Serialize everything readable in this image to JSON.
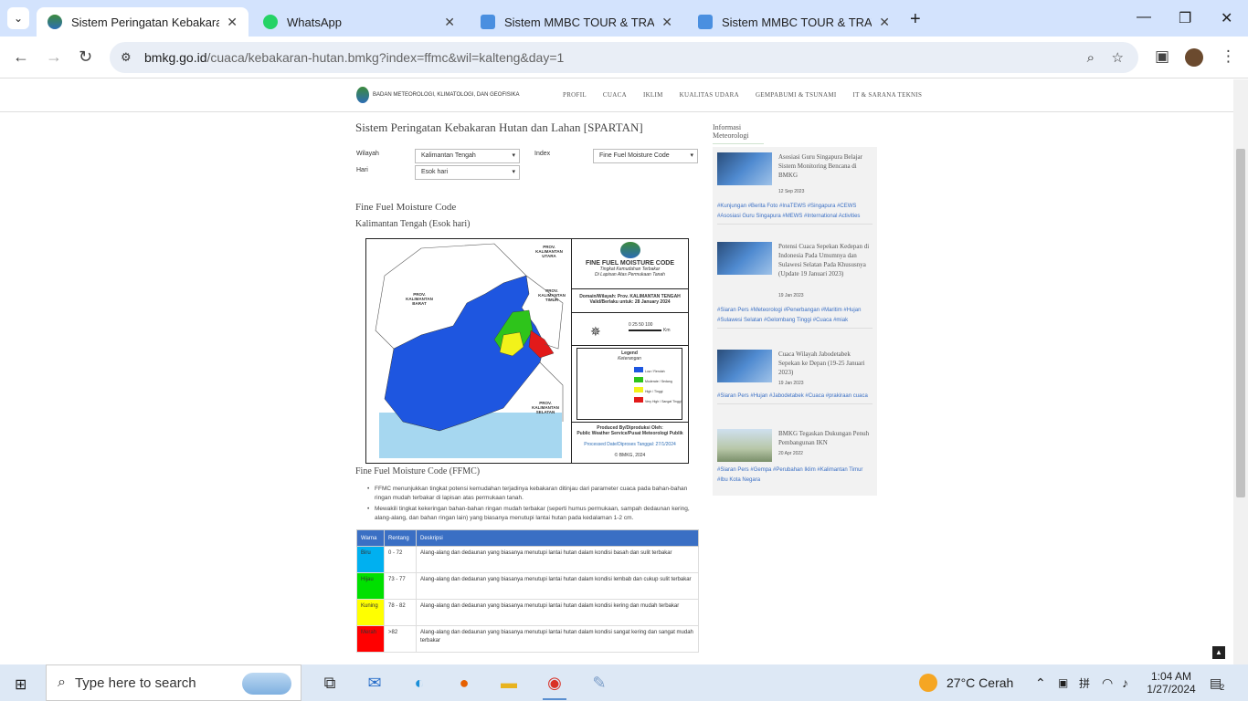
{
  "browser": {
    "tabs": [
      {
        "title": "Sistem Peringatan Kebakaran H",
        "active": true
      },
      {
        "title": "WhatsApp",
        "active": false
      },
      {
        "title": "Sistem MMBC TOUR & TRAVEL",
        "active": false
      },
      {
        "title": "Sistem MMBC TOUR & TRAVEL",
        "active": false
      }
    ],
    "url_host": "bmkg.go.id",
    "url_path": "/cuaca/kebakaran-hutan.bmkg?index=ffmc&wil=kalteng&day=1"
  },
  "site": {
    "logo_text": "BADAN METEOROLOGI, KLIMATOLOGI, DAN GEOFISIKA",
    "logo_short": "BMKG",
    "nav": [
      "PROFIL",
      "CUACA",
      "IKLIM",
      "KUALITAS UDARA",
      "GEMPABUMI & TSUNAMI",
      "IT & SARANA TEKNIS"
    ]
  },
  "main": {
    "title": "Sistem Peringatan Kebakaran Hutan dan Lahan [SPARTAN]",
    "form": {
      "wilayah_label": "Wilayah",
      "wilayah_value": "Kalimantan Tengah",
      "hari_label": "Hari",
      "hari_value": "Esok hari",
      "index_label": "Index",
      "index_value": "Fine Fuel Moisture Code"
    },
    "section_title": "Fine Fuel Moisture Code",
    "section_subtitle": "Kalimantan Tengah (Esok hari)",
    "map": {
      "heading": "FINE FUEL MOISTURE CODE",
      "sub1": "Tingkat Kemudahan Terbakar",
      "sub2": "Di Lapisan Atas Permukaan Tanah",
      "domain": "Domain/Wilayah: Prov. KALIMANTAN TENGAH",
      "valid": "Valid/Berlaku untuk: 28 January 2024",
      "legend_title": "Legend",
      "legend_sub": "Keterangan",
      "legend_items": [
        {
          "label": "Low / Rendah",
          "color": "#1e56e0"
        },
        {
          "label": "Moderate / Sedang",
          "color": "#2ec41b"
        },
        {
          "label": "High / Tinggi",
          "color": "#f2f21a"
        },
        {
          "label": "Very High / Sangat Tinggi",
          "color": "#e21a1a"
        }
      ],
      "labels": {
        "kalbar": "PROV. KALIMANTAN BARAT",
        "kaltim": "PROV. KALIMANTAN TIMUR",
        "kalsel": "PROV. KALIMANTAN SELATAN",
        "kalut": "PROV. KALIMANTAN UTARA"
      },
      "scale": "0  25 50    100",
      "scale_unit": "Km",
      "produced": "Produced By/Diproduksi Oleh:",
      "producer": "Public Weather Service/Pusat Meteorologi Publik",
      "processed": "Processed Date/Diproses Tanggal: 27/1/2024",
      "copyright": "© BMKG, 2024"
    },
    "desc_heading": "Fine Fuel Moisture Code (FFMC)",
    "bullets": [
      "FFMC menunjukkan tingkat potensi kemudahan terjadinya kebakaran ditinjau dari parameter cuaca pada bahan-bahan ringan mudah terbakar di lapisan atas permukaan tanah.",
      "Mewakili tingkat kekeringan bahan-bahan ringan mudah terbakar (seperti humus permukaan, sampah dedaunan kering, alang-alang, dan bahan ringan lain) yang biasanya menutupi lantai hutan pada kedalaman 1-2 cm."
    ],
    "table": {
      "headers": [
        "Warna",
        "Rentang",
        "Deskripsi"
      ],
      "rows": [
        {
          "warna": "Biru",
          "color": "#00b0f0",
          "rentang": "0 - 72",
          "desc": "Alang-alang dan dedaunan yang biasanya menutupi lantai hutan dalam kondisi basah dan sulit terbakar"
        },
        {
          "warna": "Hijau",
          "color": "#00e000",
          "rentang": "73 - 77",
          "desc": "Alang-alang dan dedaunan yang biasanya menutupi lantai hutan dalam kondisi lembab dan cukup sulit terbakar"
        },
        {
          "warna": "Kuning",
          "color": "#ffff00",
          "rentang": "78 - 82",
          "desc": "Alang-alang dan dedaunan yang biasanya menutupi lantai hutan dalam kondisi kering dan mudah terbakar"
        },
        {
          "warna": "Merah",
          "color": "#ff0000",
          "rentang": ">82",
          "desc": "Alang-alang dan dedaunan yang biasanya menutupi lantai hutan dalam kondisi sangat kering dan sangat mudah terbakar"
        }
      ]
    }
  },
  "sidebar": {
    "heading": "Informasi Meteorologi",
    "news": [
      {
        "title": "Asosiasi Guru Singapura Belajar Sistem Monitoring Bencana di BMKG",
        "date": "12 Sep 2023",
        "tags": "#Kunjungan #Berita Foto #InaTEWS #Singapura #CEWS #Asosiasi Guru Singapura #MEWS #International Activities"
      },
      {
        "title": "Potensi Cuaca Sepekan Kedepan di Indonesia Pada Umumnya dan Sulawesi Selatan Pada Khususnya (Update 19 Januari 2023)",
        "date": "19 Jan 2023",
        "tags": "#Siaran Pers #Meteorologi #Penerbangan #Maritim #Hujan #Sulawesi Selatan #Gelombang Tinggi #Cuaca #miak"
      },
      {
        "title": "Cuaca Wilayah Jabodetabek Sepekan ke Depan (19-25 Januari 2023)",
        "date": "19 Jan 2023",
        "tags": "#Siaran Pers #Hujan #Jabodetabek #Cuaca #prakiraan cuaca"
      },
      {
        "title": "BMKG Tegaskan Dukungan Penuh Pembangunan IKN",
        "date": "20 Apr 2022",
        "tags": "#Siaran Pers #Gempa #Perubahan Iklim #Kalimantan Timur #Ibu Kota Negara"
      }
    ]
  },
  "taskbar": {
    "search_placeholder": "Type here to search",
    "weather": "27°C  Cerah",
    "time": "1:04 AM",
    "date": "1/27/2024",
    "notif_count": "2"
  }
}
